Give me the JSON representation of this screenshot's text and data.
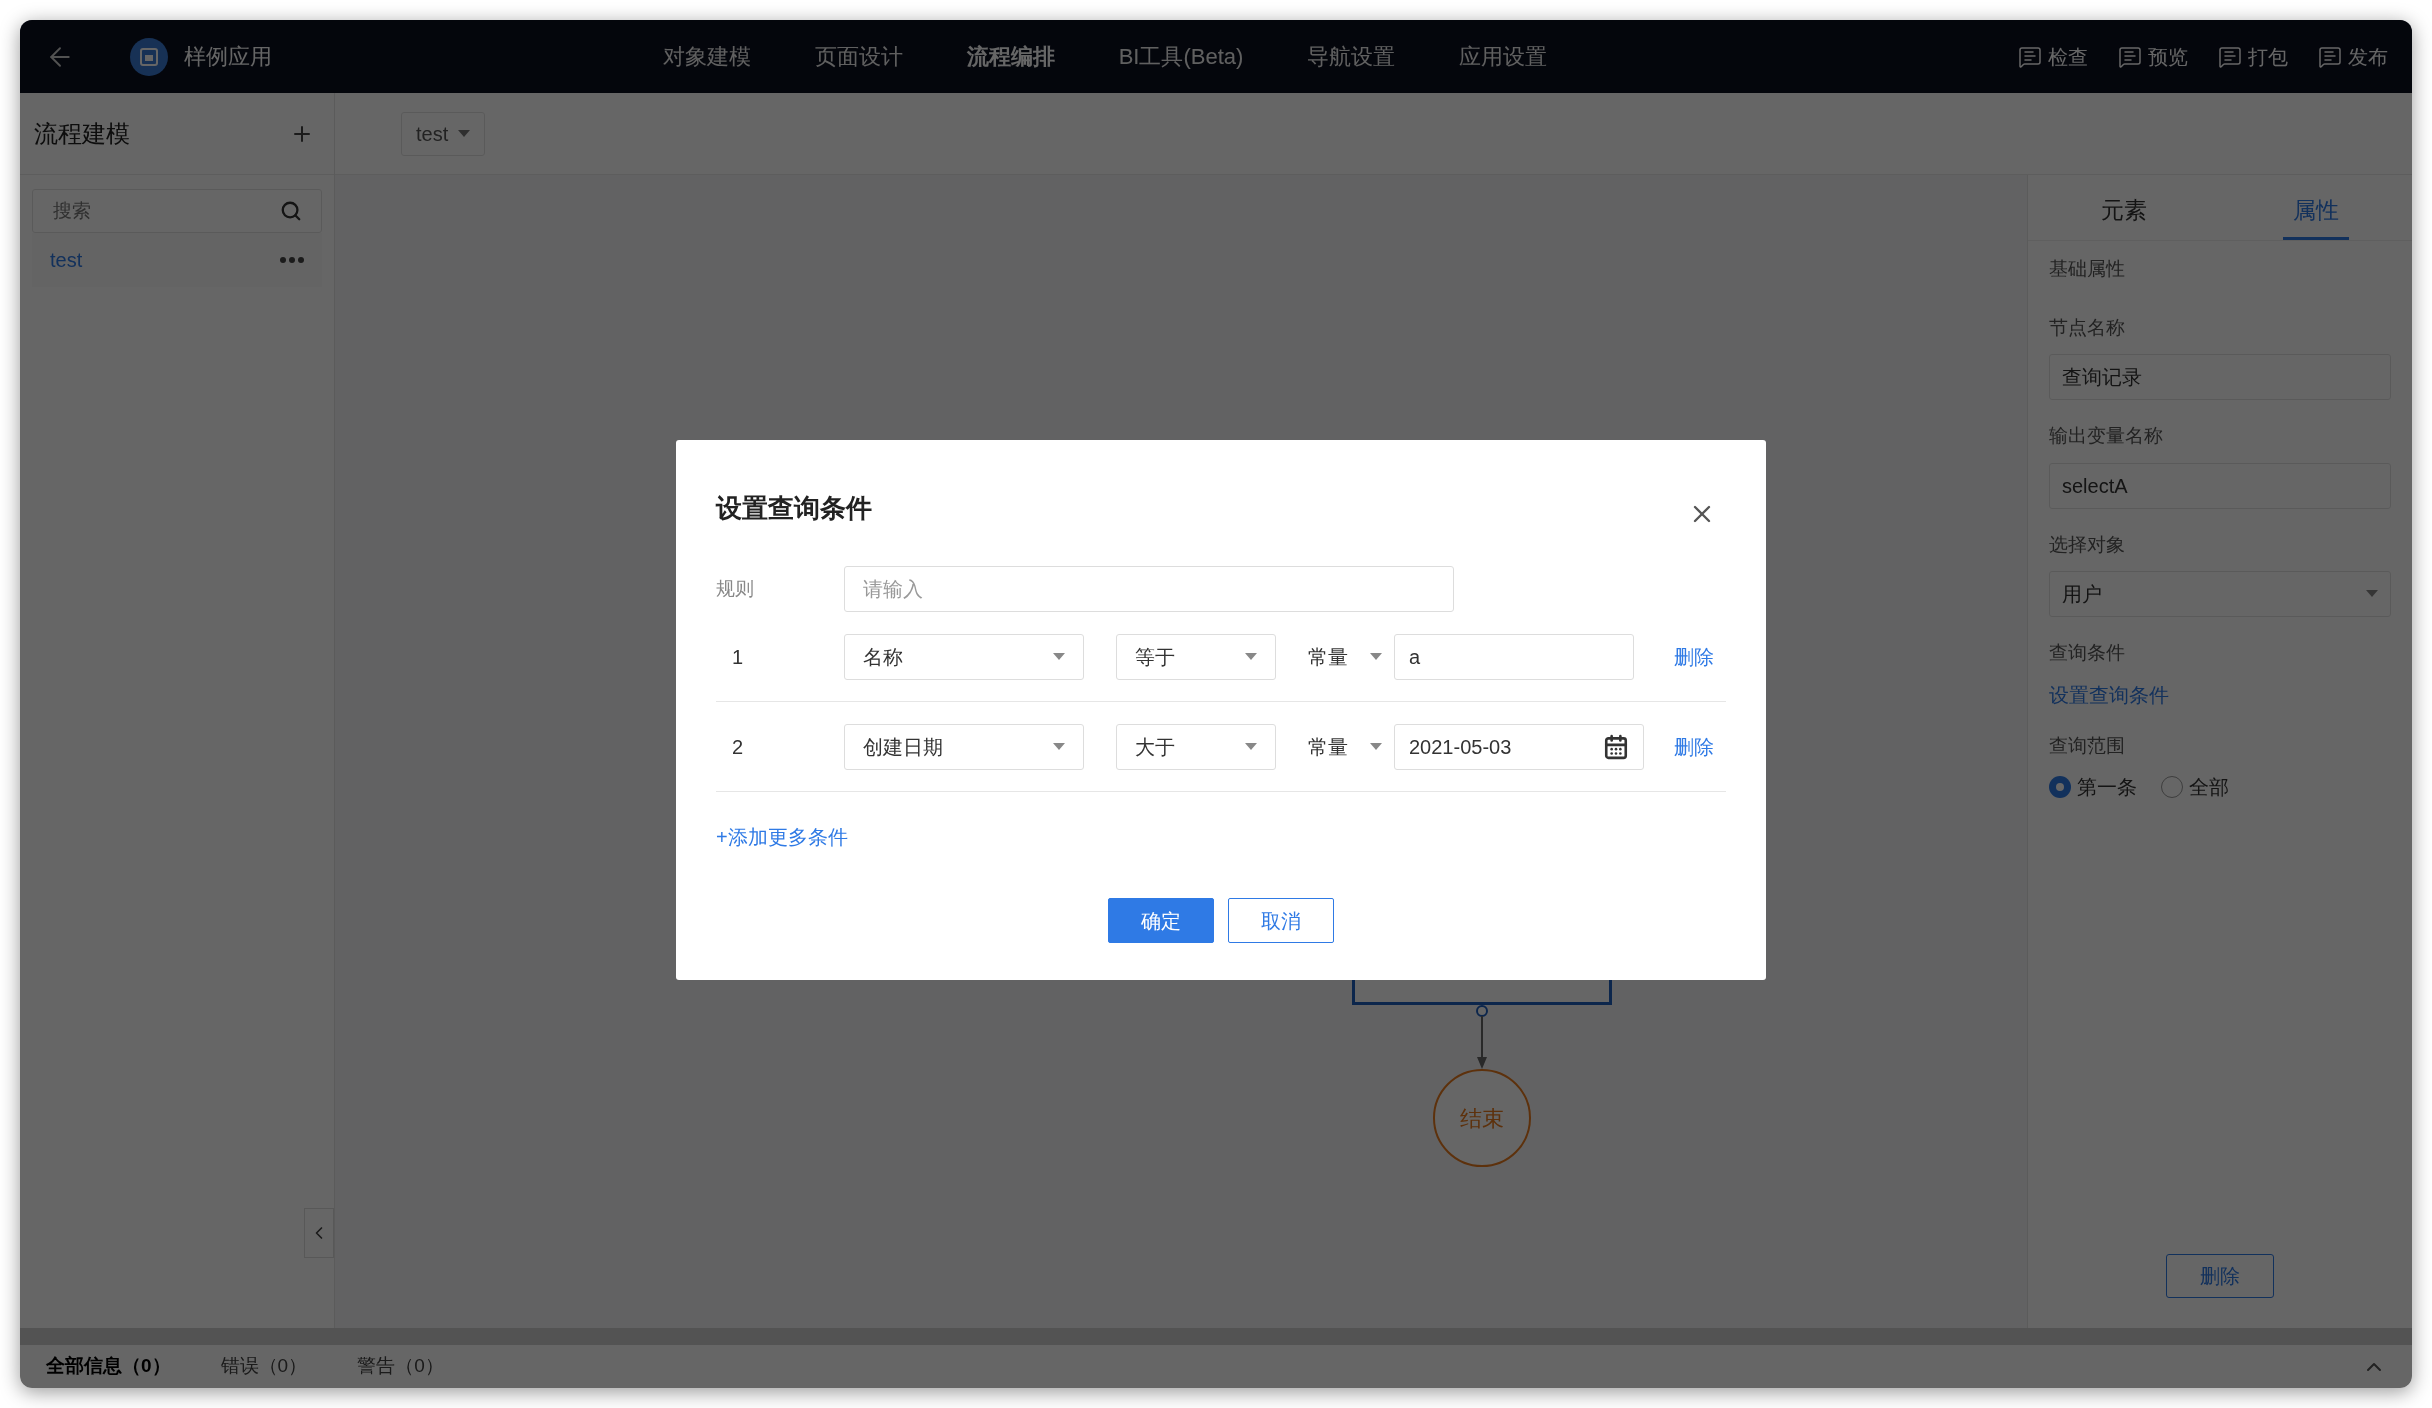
{
  "app": {
    "title": "样例应用"
  },
  "nav": [
    {
      "label": "对象建模",
      "selected": false
    },
    {
      "label": "页面设计",
      "selected": false
    },
    {
      "label": "流程编排",
      "selected": true
    },
    {
      "label": "BI工具(Beta)",
      "selected": false
    },
    {
      "label": "导航设置",
      "selected": false
    },
    {
      "label": "应用设置",
      "selected": false
    }
  ],
  "actions": [
    {
      "label": "检查"
    },
    {
      "label": "预览"
    },
    {
      "label": "打包"
    },
    {
      "label": "发布"
    }
  ],
  "sidebar": {
    "title": "流程建模",
    "search": {
      "placeholder": "搜索"
    },
    "items": [
      {
        "label": "test",
        "selected": true
      }
    ]
  },
  "canvas": {
    "process_select": "test",
    "end_node": {
      "label": "结束"
    }
  },
  "properties": {
    "tabs": [
      {
        "label": "元素",
        "selected": false
      },
      {
        "label": "属性",
        "selected": true
      }
    ],
    "section": "基础属性",
    "fields": [
      {
        "kind": "text",
        "label": "节点名称",
        "value": "查询记录"
      },
      {
        "kind": "text",
        "label": "输出变量名称",
        "value": "selectA"
      },
      {
        "kind": "select",
        "label": "选择对象",
        "value": "用户"
      },
      {
        "kind": "link",
        "label": "查询条件",
        "value": "设置查询条件"
      },
      {
        "kind": "radio",
        "label": "查询范围",
        "options": [
          {
            "label": "第一条",
            "selected": true
          },
          {
            "label": "全部",
            "selected": false
          }
        ]
      }
    ],
    "delete_button": "删除"
  },
  "messages": {
    "tabs": [
      {
        "label": "全部信息（0）",
        "selected": true
      },
      {
        "label": "错误（0）",
        "selected": false
      },
      {
        "label": "警告（0）",
        "selected": false
      }
    ]
  },
  "dialog": {
    "title": "设置查询条件",
    "rule": {
      "label": "规则",
      "placeholder": "请输入"
    },
    "conditions": [
      {
        "index": "1",
        "field": "名称",
        "operator": "等于",
        "value_type": "常量",
        "kind": "text",
        "value": "a",
        "delete": "删除"
      },
      {
        "index": "2",
        "field": "创建日期",
        "operator": "大于",
        "value_type": "常量",
        "kind": "date",
        "value": "2021-05-03",
        "delete": "删除"
      }
    ],
    "add_link": "+添加更多条件",
    "buttons": [
      {
        "kind": "primary",
        "label": "确定"
      },
      {
        "kind": "default",
        "label": "取消"
      }
    ]
  }
}
